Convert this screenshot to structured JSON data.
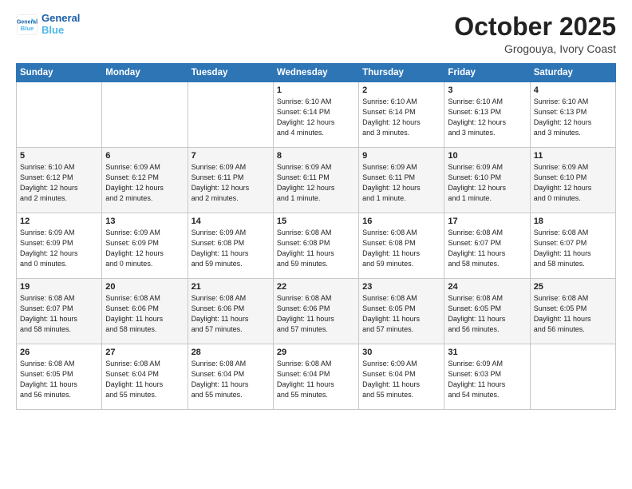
{
  "header": {
    "logo_line1": "General",
    "logo_line2": "Blue",
    "month": "October 2025",
    "location": "Grogouya, Ivory Coast"
  },
  "weekdays": [
    "Sunday",
    "Monday",
    "Tuesday",
    "Wednesday",
    "Thursday",
    "Friday",
    "Saturday"
  ],
  "weeks": [
    [
      {
        "day": "",
        "info": ""
      },
      {
        "day": "",
        "info": ""
      },
      {
        "day": "",
        "info": ""
      },
      {
        "day": "1",
        "info": "Sunrise: 6:10 AM\nSunset: 6:14 PM\nDaylight: 12 hours\nand 4 minutes."
      },
      {
        "day": "2",
        "info": "Sunrise: 6:10 AM\nSunset: 6:14 PM\nDaylight: 12 hours\nand 3 minutes."
      },
      {
        "day": "3",
        "info": "Sunrise: 6:10 AM\nSunset: 6:13 PM\nDaylight: 12 hours\nand 3 minutes."
      },
      {
        "day": "4",
        "info": "Sunrise: 6:10 AM\nSunset: 6:13 PM\nDaylight: 12 hours\nand 3 minutes."
      }
    ],
    [
      {
        "day": "5",
        "info": "Sunrise: 6:10 AM\nSunset: 6:12 PM\nDaylight: 12 hours\nand 2 minutes."
      },
      {
        "day": "6",
        "info": "Sunrise: 6:09 AM\nSunset: 6:12 PM\nDaylight: 12 hours\nand 2 minutes."
      },
      {
        "day": "7",
        "info": "Sunrise: 6:09 AM\nSunset: 6:11 PM\nDaylight: 12 hours\nand 2 minutes."
      },
      {
        "day": "8",
        "info": "Sunrise: 6:09 AM\nSunset: 6:11 PM\nDaylight: 12 hours\nand 1 minute."
      },
      {
        "day": "9",
        "info": "Sunrise: 6:09 AM\nSunset: 6:11 PM\nDaylight: 12 hours\nand 1 minute."
      },
      {
        "day": "10",
        "info": "Sunrise: 6:09 AM\nSunset: 6:10 PM\nDaylight: 12 hours\nand 1 minute."
      },
      {
        "day": "11",
        "info": "Sunrise: 6:09 AM\nSunset: 6:10 PM\nDaylight: 12 hours\nand 0 minutes."
      }
    ],
    [
      {
        "day": "12",
        "info": "Sunrise: 6:09 AM\nSunset: 6:09 PM\nDaylight: 12 hours\nand 0 minutes."
      },
      {
        "day": "13",
        "info": "Sunrise: 6:09 AM\nSunset: 6:09 PM\nDaylight: 12 hours\nand 0 minutes."
      },
      {
        "day": "14",
        "info": "Sunrise: 6:09 AM\nSunset: 6:08 PM\nDaylight: 11 hours\nand 59 minutes."
      },
      {
        "day": "15",
        "info": "Sunrise: 6:08 AM\nSunset: 6:08 PM\nDaylight: 11 hours\nand 59 minutes."
      },
      {
        "day": "16",
        "info": "Sunrise: 6:08 AM\nSunset: 6:08 PM\nDaylight: 11 hours\nand 59 minutes."
      },
      {
        "day": "17",
        "info": "Sunrise: 6:08 AM\nSunset: 6:07 PM\nDaylight: 11 hours\nand 58 minutes."
      },
      {
        "day": "18",
        "info": "Sunrise: 6:08 AM\nSunset: 6:07 PM\nDaylight: 11 hours\nand 58 minutes."
      }
    ],
    [
      {
        "day": "19",
        "info": "Sunrise: 6:08 AM\nSunset: 6:07 PM\nDaylight: 11 hours\nand 58 minutes."
      },
      {
        "day": "20",
        "info": "Sunrise: 6:08 AM\nSunset: 6:06 PM\nDaylight: 11 hours\nand 58 minutes."
      },
      {
        "day": "21",
        "info": "Sunrise: 6:08 AM\nSunset: 6:06 PM\nDaylight: 11 hours\nand 57 minutes."
      },
      {
        "day": "22",
        "info": "Sunrise: 6:08 AM\nSunset: 6:06 PM\nDaylight: 11 hours\nand 57 minutes."
      },
      {
        "day": "23",
        "info": "Sunrise: 6:08 AM\nSunset: 6:05 PM\nDaylight: 11 hours\nand 57 minutes."
      },
      {
        "day": "24",
        "info": "Sunrise: 6:08 AM\nSunset: 6:05 PM\nDaylight: 11 hours\nand 56 minutes."
      },
      {
        "day": "25",
        "info": "Sunrise: 6:08 AM\nSunset: 6:05 PM\nDaylight: 11 hours\nand 56 minutes."
      }
    ],
    [
      {
        "day": "26",
        "info": "Sunrise: 6:08 AM\nSunset: 6:05 PM\nDaylight: 11 hours\nand 56 minutes."
      },
      {
        "day": "27",
        "info": "Sunrise: 6:08 AM\nSunset: 6:04 PM\nDaylight: 11 hours\nand 55 minutes."
      },
      {
        "day": "28",
        "info": "Sunrise: 6:08 AM\nSunset: 6:04 PM\nDaylight: 11 hours\nand 55 minutes."
      },
      {
        "day": "29",
        "info": "Sunrise: 6:08 AM\nSunset: 6:04 PM\nDaylight: 11 hours\nand 55 minutes."
      },
      {
        "day": "30",
        "info": "Sunrise: 6:09 AM\nSunset: 6:04 PM\nDaylight: 11 hours\nand 55 minutes."
      },
      {
        "day": "31",
        "info": "Sunrise: 6:09 AM\nSunset: 6:03 PM\nDaylight: 11 hours\nand 54 minutes."
      },
      {
        "day": "",
        "info": ""
      }
    ]
  ]
}
